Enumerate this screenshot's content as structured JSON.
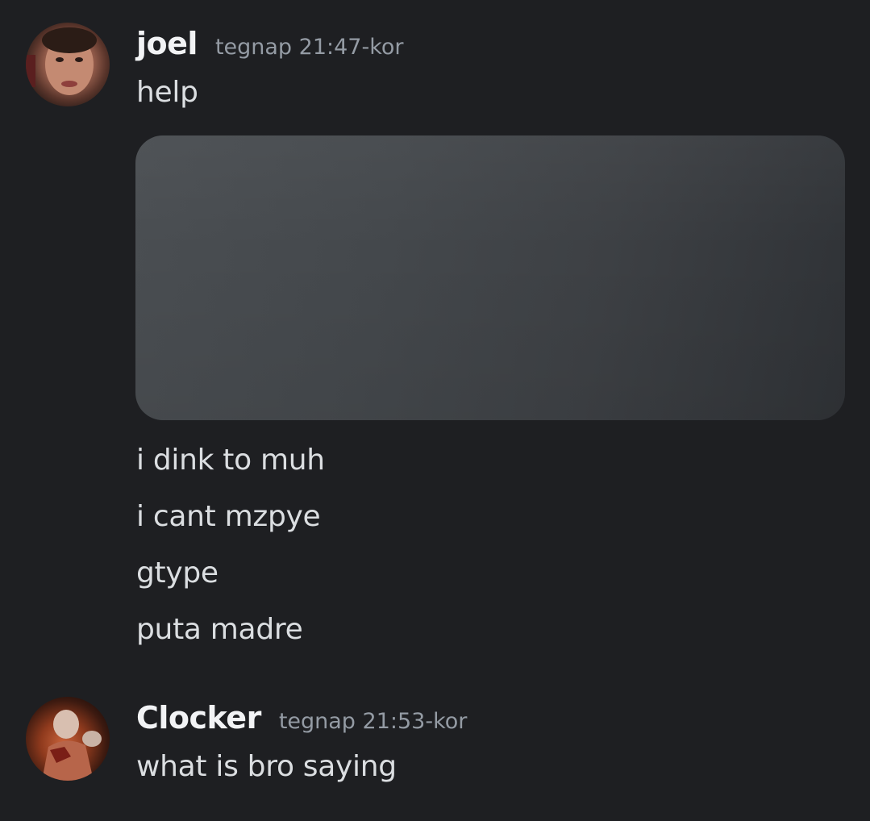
{
  "messages": [
    {
      "author": "joel",
      "timestamp": "tegnap 21:47-kor",
      "avatar_icon": "user-avatar-photo",
      "lines": [
        "help"
      ],
      "attachment": "hidden-image-placeholder",
      "followups": [
        "i dink to muh",
        "i cant mzpye",
        "gtype",
        "puta madre"
      ]
    },
    {
      "author": "Clocker",
      "timestamp": "tegnap 21:53-kor",
      "avatar_icon": "user-avatar-photo",
      "lines": [
        "what is bro saying"
      ]
    }
  ],
  "colors": {
    "background": "#1e1f22",
    "username": "#f2f3f5",
    "timestamp": "#949ba4",
    "message_text": "#dbdee1",
    "attachment_placeholder": "#44484c"
  }
}
